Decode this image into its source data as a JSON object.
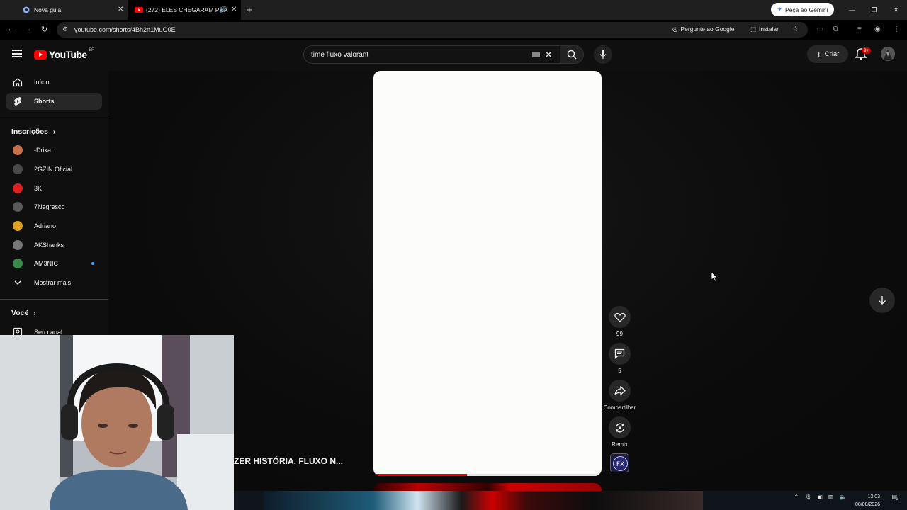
{
  "browser": {
    "tabs": [
      {
        "title": "Nova guia",
        "active": false
      },
      {
        "title": "(272) ELES CHEGARAM PRA",
        "active": true
      }
    ],
    "gemini_button": "Peça ao Gemini",
    "url": "youtube.com/shorts/4Bh2n1MuO0E",
    "ask_google": "Pergunte ao Google",
    "install": "Instalar"
  },
  "youtube": {
    "logo_text": "YouTube",
    "logo_country": "BR",
    "search_value": "time fluxo valorant",
    "create_label": "Criar",
    "notifications_badge": "9+",
    "sidebar": {
      "main": [
        {
          "label": "Início",
          "selected": false,
          "icon": "home-icon"
        },
        {
          "label": "Shorts",
          "selected": true,
          "icon": "shorts-icon"
        }
      ],
      "subscriptions_title": "Inscrições",
      "subscriptions": [
        {
          "name": "-Drika.",
          "color": "#c8704a",
          "live": false
        },
        {
          "name": "2GZIN Oficial",
          "color": "#4a4a4a",
          "live": false
        },
        {
          "name": "3K",
          "color": "#e02020",
          "live": false
        },
        {
          "name": "7Negresco",
          "color": "#5a5a5a",
          "live": false
        },
        {
          "name": "Adriano",
          "color": "#e0a020",
          "live": false
        },
        {
          "name": "AKShanks",
          "color": "#777777",
          "live": false
        },
        {
          "name": "AM3NIC",
          "color": "#3a8a4a",
          "live": true
        }
      ],
      "show_more": "Mostrar mais",
      "you_title": "Você",
      "your_channel": "Seu canal"
    },
    "short": {
      "title": "ZER HISTÓRIA, FLUXO N...",
      "progress": 0.41,
      "likes": "99",
      "comments": "5",
      "share_label": "Compartilhar",
      "remix_label": "Remix"
    }
  },
  "taskbar": {
    "time": "13:03",
    "date": "08/08/2026",
    "notification_count": "2"
  },
  "colors": {
    "brand_red": "#ff0000",
    "accent_blue": "#3ea6ff",
    "background": "#0f0f0f"
  }
}
